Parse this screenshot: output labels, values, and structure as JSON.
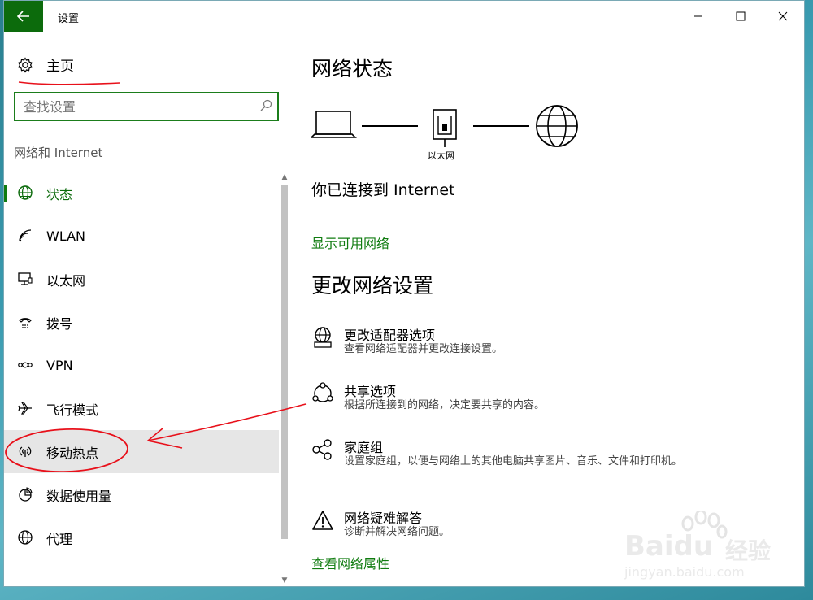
{
  "window": {
    "title": "设置",
    "back_icon": "arrow-left-icon",
    "accent_color": "#107c10"
  },
  "sidebar": {
    "home_label": "主页",
    "search_placeholder": "查找设置",
    "section_label": "网络和 Internet",
    "items": [
      {
        "label": "状态",
        "icon": "globe-icon",
        "active": true
      },
      {
        "label": "WLAN",
        "icon": "wifi-icon"
      },
      {
        "label": "以太网",
        "icon": "ethernet-icon"
      },
      {
        "label": "拨号",
        "icon": "dialup-icon"
      },
      {
        "label": "VPN",
        "icon": "vpn-icon"
      },
      {
        "label": "飞行模式",
        "icon": "airplane-icon"
      },
      {
        "label": "移动热点",
        "icon": "hotspot-icon",
        "highlighted": true
      },
      {
        "label": "数据使用量",
        "icon": "pie-chart-icon"
      },
      {
        "label": "代理",
        "icon": "proxy-globe-icon"
      }
    ]
  },
  "main": {
    "title": "网络状态",
    "diagram_label": "以太网",
    "connected_text": "你已连接到 Internet",
    "show_networks_link": "显示可用网络",
    "section_title": "更改网络设置",
    "options": [
      {
        "title": "更改适配器选项",
        "desc": "查看网络适配器并更改连接设置。",
        "icon": "adapter-globe-icon"
      },
      {
        "title": "共享选项",
        "desc": "根据所连接到的网络，决定要共享的内容。",
        "icon": "share-icon"
      },
      {
        "title": "家庭组",
        "desc": "设置家庭组，以便与网络上的其他电脑共享图片、音乐、文件和打印机。",
        "icon": "homegroup-icon"
      },
      {
        "title": "网络疑难解答",
        "desc": "诊断并解决网络问题。",
        "icon": "warning-icon"
      }
    ],
    "view_properties_link": "查看网络属性"
  },
  "watermark": {
    "brand": "Baidu",
    "brand_cn": "经验",
    "url": "jingyan.baidu.com"
  }
}
